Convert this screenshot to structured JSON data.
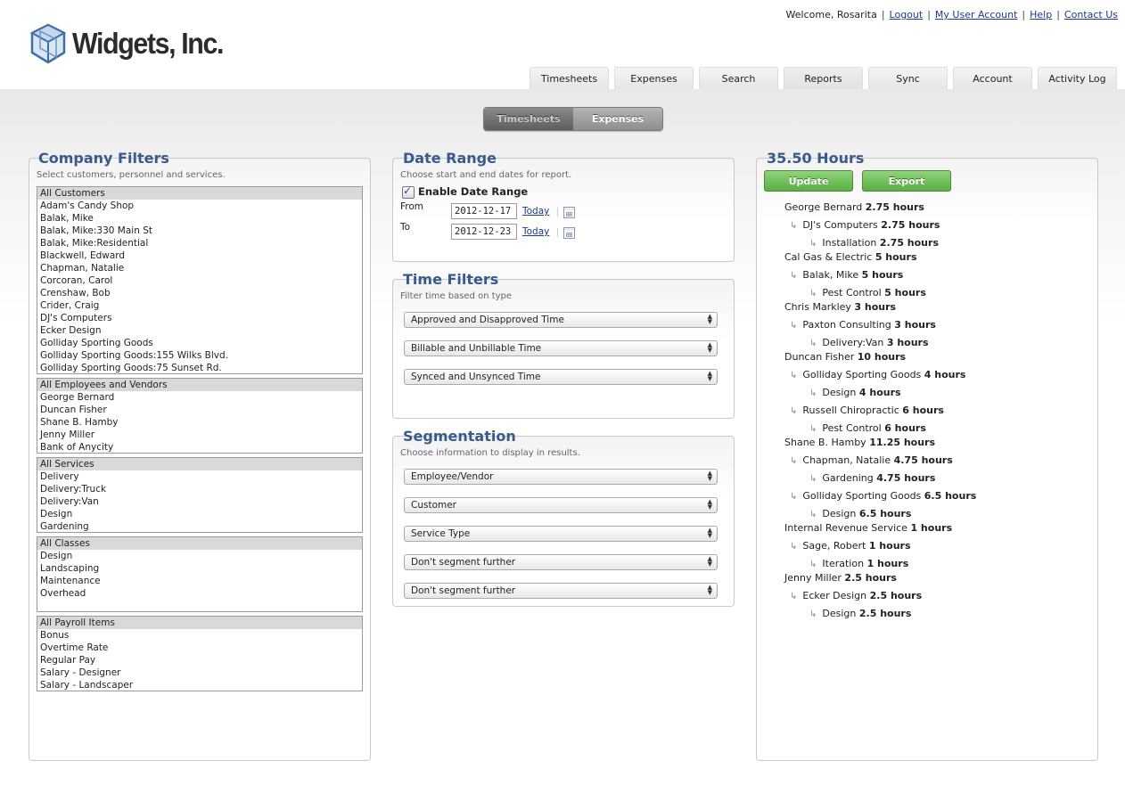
{
  "header": {
    "logo_text": "Widgets, Inc.",
    "welcome": "Welcome, Rosarita",
    "links": [
      "Logout",
      "My User Account",
      "Help",
      "Contact Us"
    ],
    "tabs": [
      "Timesheets",
      "Expenses",
      "Search",
      "Reports",
      "Sync",
      "Account",
      "Activity Log"
    ],
    "active_tab": "Reports"
  },
  "toggle": {
    "timesheets": "Timesheets",
    "expenses": "Expenses",
    "active": "Expenses"
  },
  "company_filters": {
    "title": "Company Filters",
    "subtitle": "Select customers, personnel and services.",
    "customers": [
      "All Customers",
      "Adam's Candy Shop",
      "Balak, Mike",
      "Balak, Mike:330 Main St",
      "Balak, Mike:Residential",
      "Blackwell, Edward",
      "Chapman, Natalie",
      "Corcoran, Carol",
      "Crenshaw, Bob",
      "Crider, Craig",
      "DJ's Computers",
      "Ecker Design",
      "Golliday Sporting Goods",
      "Golliday Sporting Goods:155 Wilks Blvd.",
      "Golliday Sporting Goods:75 Sunset Rd."
    ],
    "employees": [
      "All Employees and Vendors",
      "George Bernard",
      "Duncan Fisher",
      "Shane B. Hamby",
      "Jenny Miller",
      "Bank of Anycity"
    ],
    "services": [
      "All Services",
      "Delivery",
      "Delivery:Truck",
      "Delivery:Van",
      "Design",
      "Gardening"
    ],
    "classes": [
      "All Classes",
      "Design",
      "Landscaping",
      "Maintenance",
      "Overhead"
    ],
    "payroll": [
      "All Payroll Items",
      "Bonus",
      "Overtime Rate",
      "Regular Pay",
      "Salary - Designer",
      "Salary - Landscaper"
    ]
  },
  "date_range": {
    "title": "Date Range",
    "subtitle": "Choose start and end dates for report.",
    "enable_label": "Enable Date Range",
    "enabled": true,
    "from_label": "From",
    "from_value": "2012-12-17",
    "to_label": "To",
    "to_value": "2012-12-23",
    "today": "Today"
  },
  "time_filters": {
    "title": "Time Filters",
    "subtitle": "Filter time based on type",
    "selects": [
      "Approved and Disapproved Time",
      "Billable and Unbillable Time",
      "Synced and Unsynced Time"
    ]
  },
  "segmentation": {
    "title": "Segmentation",
    "subtitle": "Choose information to display in results.",
    "selects": [
      "Employee/Vendor",
      "Customer",
      "Service Type",
      "Don't segment further",
      "Don't segment further"
    ]
  },
  "results": {
    "title": "35.50 Hours",
    "update": "Update",
    "export": "Export",
    "lines": [
      {
        "level": 0,
        "name": "George Bernard",
        "hours": "2.75 hours"
      },
      {
        "level": 1,
        "name": "DJ's Computers",
        "hours": "2.75 hours"
      },
      {
        "level": 2,
        "name": "Installation",
        "hours": "2.75 hours"
      },
      {
        "level": 0,
        "name": "Cal Gas & Electric",
        "hours": "5 hours"
      },
      {
        "level": 1,
        "name": "Balak, Mike",
        "hours": "5 hours"
      },
      {
        "level": 2,
        "name": "Pest Control",
        "hours": "5 hours"
      },
      {
        "level": 0,
        "name": "Chris Markley",
        "hours": "3 hours"
      },
      {
        "level": 1,
        "name": "Paxton Consulting",
        "hours": "3 hours"
      },
      {
        "level": 2,
        "name": "Delivery:Van",
        "hours": "3 hours"
      },
      {
        "level": 0,
        "name": "Duncan Fisher",
        "hours": "10 hours"
      },
      {
        "level": 1,
        "name": "Golliday Sporting Goods",
        "hours": "4 hours"
      },
      {
        "level": 2,
        "name": "Design",
        "hours": "4 hours"
      },
      {
        "level": 1,
        "name": "Russell Chiropractic",
        "hours": "6 hours"
      },
      {
        "level": 2,
        "name": "Pest Control",
        "hours": "6 hours"
      },
      {
        "level": 0,
        "name": "Shane B. Hamby",
        "hours": "11.25 hours"
      },
      {
        "level": 1,
        "name": "Chapman, Natalie",
        "hours": "4.75 hours"
      },
      {
        "level": 2,
        "name": "Gardening",
        "hours": "4.75 hours"
      },
      {
        "level": 1,
        "name": "Golliday Sporting Goods",
        "hours": "6.5 hours"
      },
      {
        "level": 2,
        "name": "Design",
        "hours": "6.5 hours"
      },
      {
        "level": 0,
        "name": "Internal Revenue Service",
        "hours": "1 hours"
      },
      {
        "level": 1,
        "name": "Sage, Robert",
        "hours": "1 hours"
      },
      {
        "level": 2,
        "name": "Iteration",
        "hours": "1 hours"
      },
      {
        "level": 0,
        "name": "Jenny Miller",
        "hours": "2.5 hours"
      },
      {
        "level": 1,
        "name": "Ecker Design",
        "hours": "2.5 hours"
      },
      {
        "level": 2,
        "name": "Design",
        "hours": "2.5 hours"
      }
    ]
  }
}
